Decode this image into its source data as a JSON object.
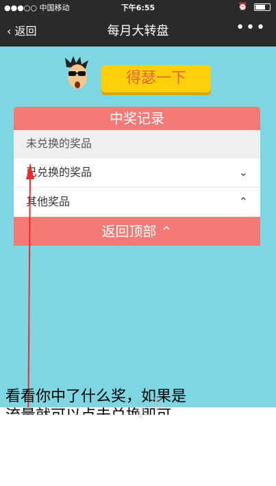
{
  "status": {
    "carrier": "●●●○○ 中国移动",
    "time": "下午6:55",
    "battery_level": 0.7
  },
  "nav": {
    "back_label": "返回",
    "title": "每月大转盘",
    "more": "•••"
  },
  "shake_button": "得瑟一下",
  "records": {
    "title": "中奖记录",
    "items": [
      {
        "label": "未兑换的奖品",
        "chevron": ""
      },
      {
        "label": "已兑换的奖品",
        "chevron": "⌄"
      },
      {
        "label": "其他奖品",
        "chevron": "⌃"
      }
    ],
    "back_to_top": "返回顶部 ⌃"
  },
  "caption": {
    "line1": "看看你中了什么奖，如果是",
    "line2": "流量就可以点击兑换即可"
  },
  "colors": {
    "nav_bg": "#2a2a2a",
    "page_bg": "#7fd6e3",
    "panel_head": "#f47a75",
    "button": "#ffcf09",
    "button_text": "#e0663a",
    "arrow": "#f02a2a"
  }
}
